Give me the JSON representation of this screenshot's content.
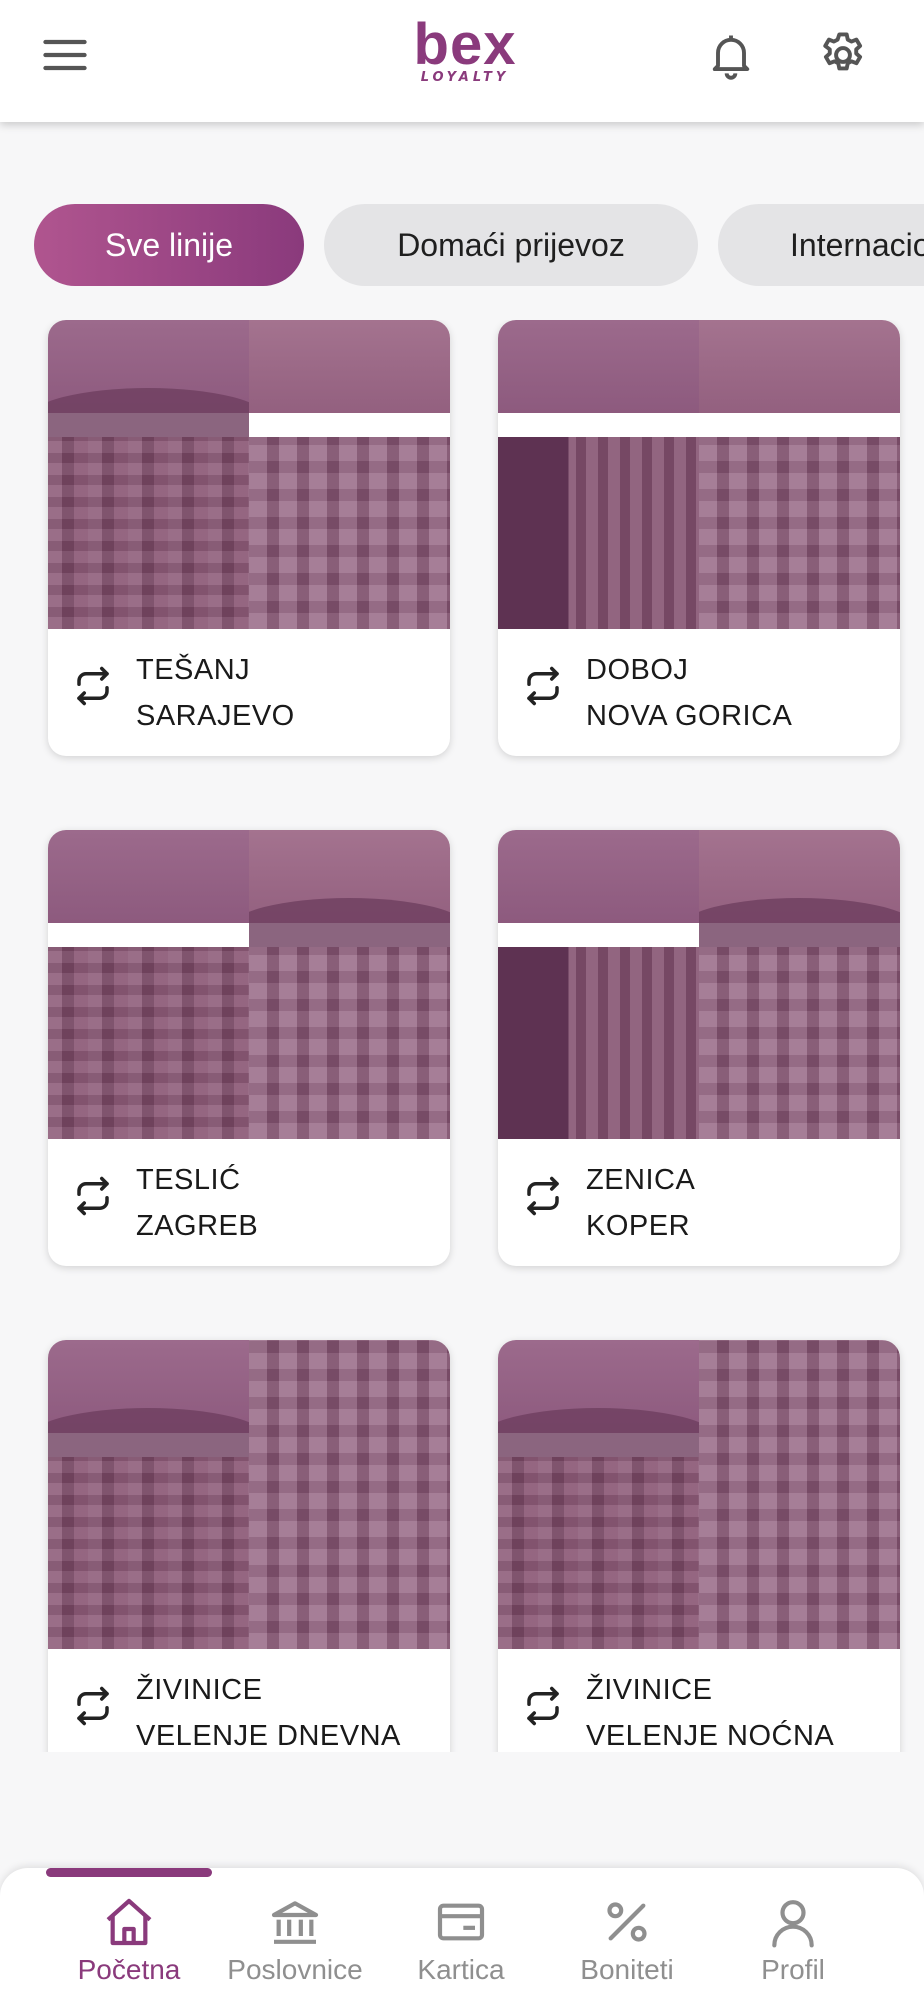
{
  "header": {
    "logo_main": "bex",
    "logo_sub": "LOYALTY",
    "menu_icon": "menu-icon",
    "notifications_icon": "bell-icon",
    "settings_icon": "gear-icon"
  },
  "filters": [
    {
      "label": "Sve linije",
      "active": true
    },
    {
      "label": "Domaći prijevoz",
      "active": false
    },
    {
      "label": "Internacionalni prijevoz",
      "active": false
    }
  ],
  "routes": [
    {
      "from": "TEŠANJ",
      "to": "SARAJEVO"
    },
    {
      "from": "DOBOJ",
      "to": "NOVA GORICA"
    },
    {
      "from": "TESLIĆ",
      "to": "ZAGREB"
    },
    {
      "from": "ZENICA",
      "to": "KOPER"
    },
    {
      "from": "ŽIVINICE",
      "to": "VELENJE DNEVNA"
    },
    {
      "from": "ŽIVINICE",
      "to": "VELENJE NOĆNA"
    }
  ],
  "bottom_nav": [
    {
      "label": "Početna",
      "icon": "home-icon",
      "active": true
    },
    {
      "label": "Poslovnice",
      "icon": "bank-icon",
      "active": false
    },
    {
      "label": "Kartica",
      "icon": "card-icon",
      "active": false
    },
    {
      "label": "Boniteti",
      "icon": "percent-icon",
      "active": false
    },
    {
      "label": "Profil",
      "icon": "user-icon",
      "active": false
    }
  ],
  "colors": {
    "brand": "#8a3a7c",
    "chip_inactive": "#e4e4e6",
    "background": "#f7f7f8"
  }
}
